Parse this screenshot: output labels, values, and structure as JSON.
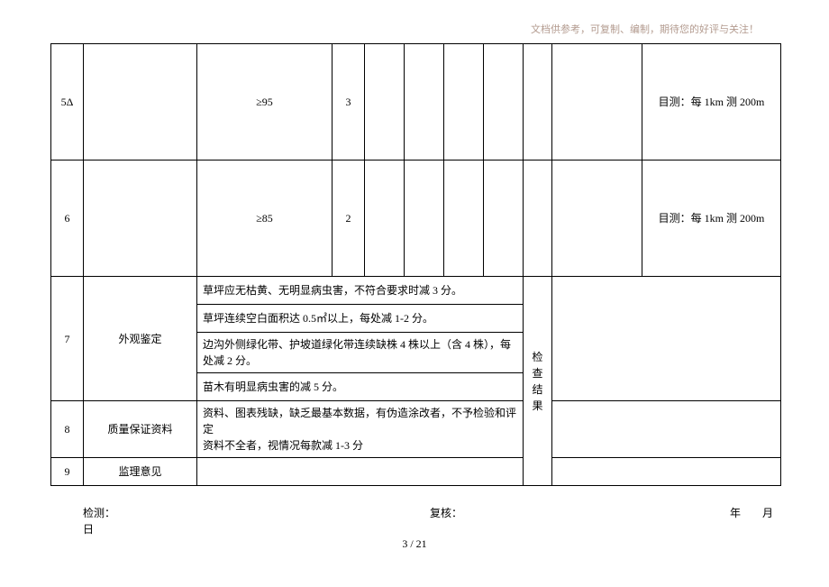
{
  "header_note": "文档供参考，可复制、编制，期待您的好评与关注！",
  "rows_top": [
    {
      "no": "5Δ",
      "std": "≥95",
      "score": "3",
      "method": "目测：每 1km 测 200m"
    },
    {
      "no": "6",
      "std": "≥85",
      "score": "2",
      "method": "目测：每 1km 测 200m"
    }
  ],
  "row7": {
    "no": "7",
    "label": "外观鉴定",
    "lines": [
      "草坪应无枯黄、无明显病虫害，不符合要求时减 3 分。",
      "草坪连续空白面积达 0.5㎡以上，每处减 1-2 分。",
      "边沟外侧绿化带、护坡道绿化带连续缺株 4 株以上（含 4 株），每处减 2 分。",
      "苗木有明显病虫害的减 5 分。"
    ],
    "result_label": "检查\n结果"
  },
  "row8": {
    "no": "8",
    "label": "质量保证资料",
    "text": "资料、图表残缺，缺乏最基本数据，有伪造涂改者，不予检验和评定\n资料不全者，视情况每款减 1-3 分"
  },
  "row9": {
    "no": "9",
    "label": "监理意见"
  },
  "footer": {
    "jc": "检测：",
    "fh": "复核：",
    "nm": "年　　月",
    "day": "日"
  },
  "pager": "3 / 21"
}
